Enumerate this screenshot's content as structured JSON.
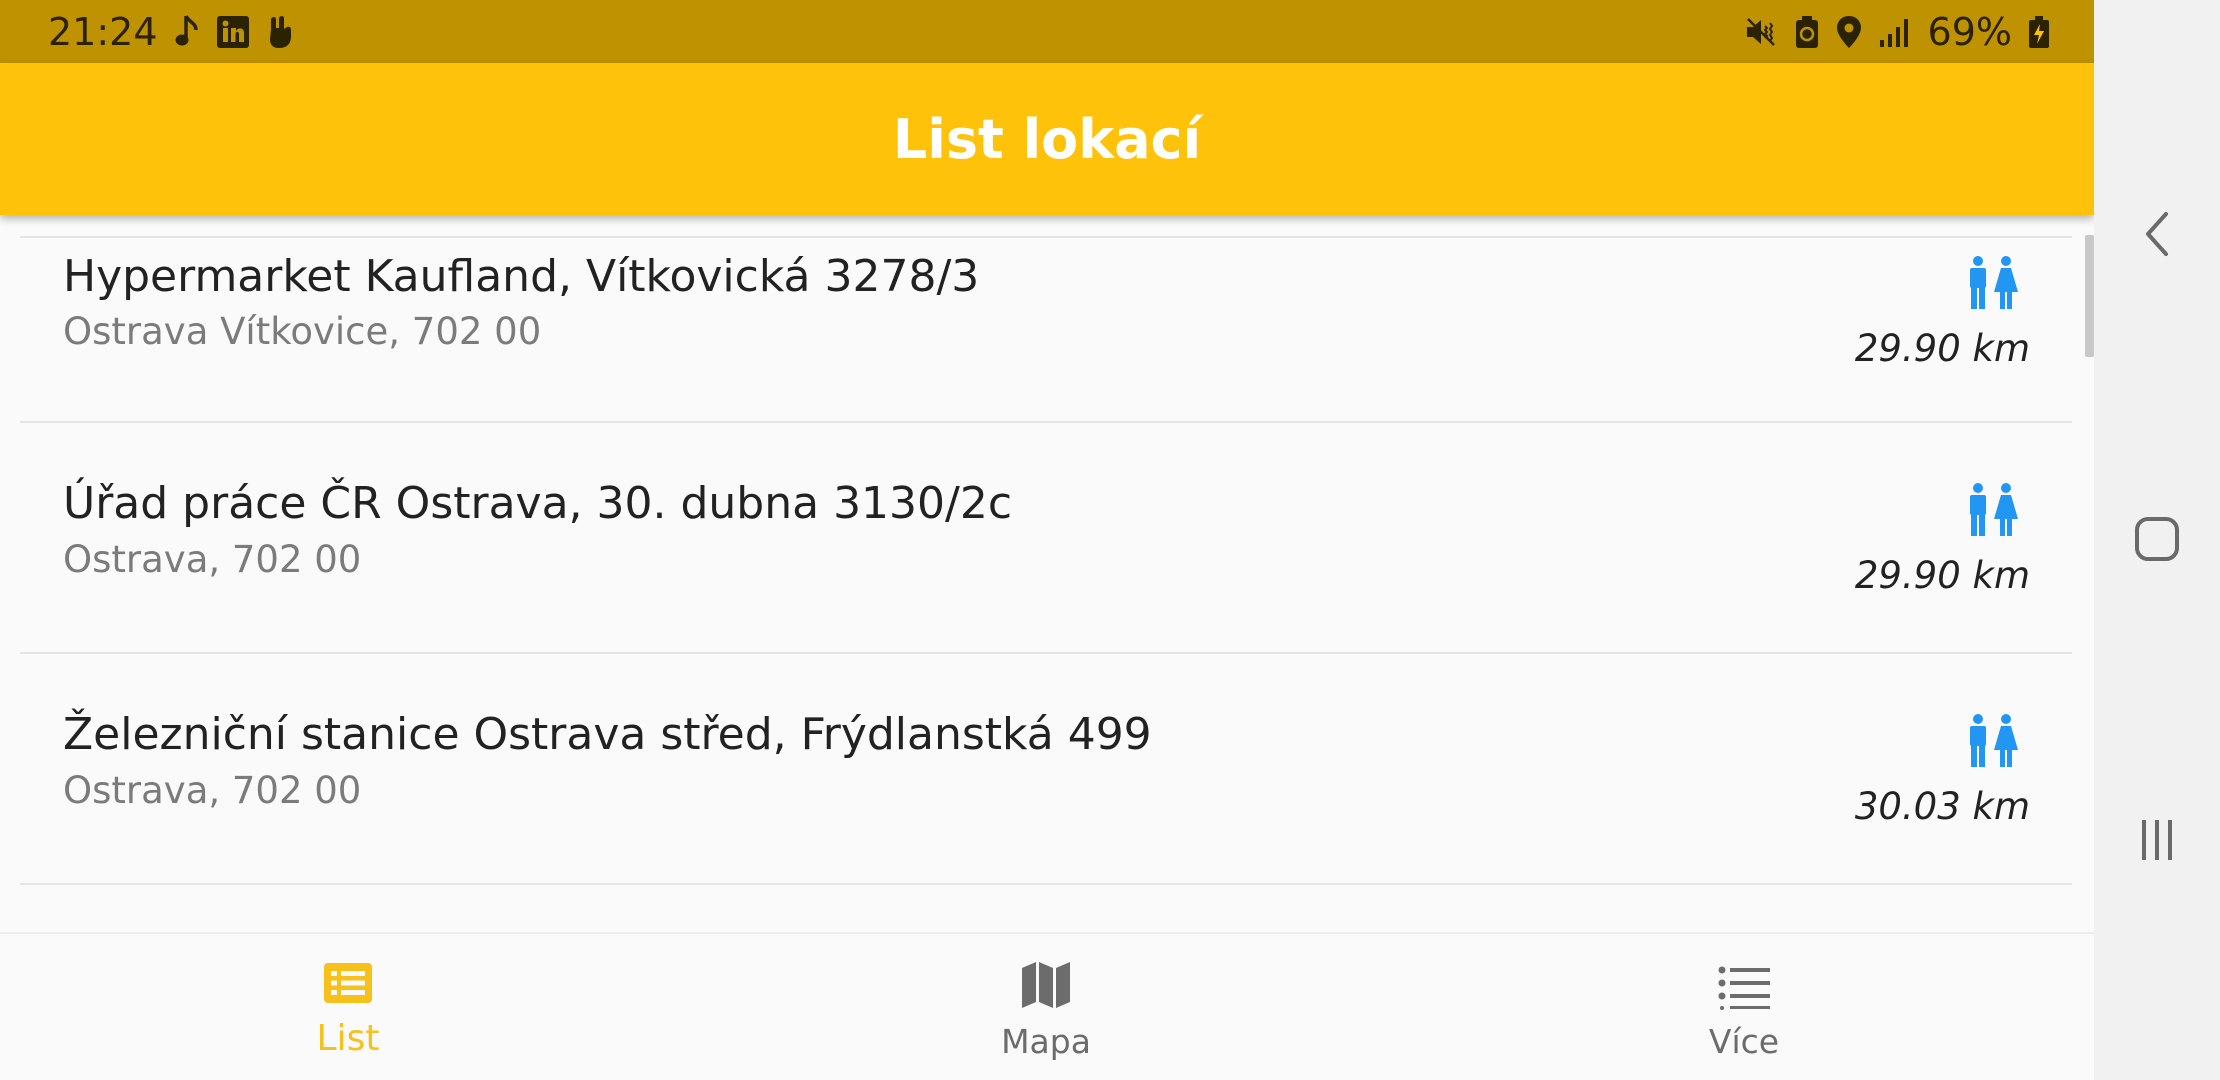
{
  "status_bar": {
    "time": "21:24",
    "battery": "69%",
    "left_icons": [
      "music-note-icon",
      "linkedin-icon",
      "hand-gesture-icon"
    ],
    "right_icons": [
      "vibrate-mute-icon",
      "battery-saver-icon",
      "location-icon",
      "signal-icon",
      "battery-charging-icon"
    ]
  },
  "app_bar": {
    "title": "List lokací"
  },
  "locations": [
    {
      "title": "Hypermarket Kaufland, Vítkovická 3278/3",
      "subtitle": "Ostrava Vítkovice, 702 00",
      "distance": "29.90 km",
      "icon": "restroom-icon"
    },
    {
      "title": "Úřad práce ČR Ostrava, 30. dubna 3130/2c",
      "subtitle": "Ostrava, 702 00",
      "distance": "29.90 km",
      "icon": "restroom-icon"
    },
    {
      "title": "Železniční stanice Ostrava střed, Frýdlanstká 499",
      "subtitle": "Ostrava, 702 00",
      "distance": "30.03 km",
      "icon": "restroom-icon"
    }
  ],
  "bottom_nav": [
    {
      "label": "List",
      "icon": "list-icon",
      "active": true
    },
    {
      "label": "Mapa",
      "icon": "map-icon",
      "active": false
    },
    {
      "label": "Více",
      "icon": "more-list-icon",
      "active": false
    }
  ],
  "system_nav": [
    "back-icon",
    "home-icon",
    "recents-icon"
  ],
  "colors": {
    "status_bar": "#bf9202",
    "app_bar": "#ffc20a",
    "accent": "#f7c01b",
    "restroom_icon": "#2196f3",
    "background": "#fafafa"
  }
}
